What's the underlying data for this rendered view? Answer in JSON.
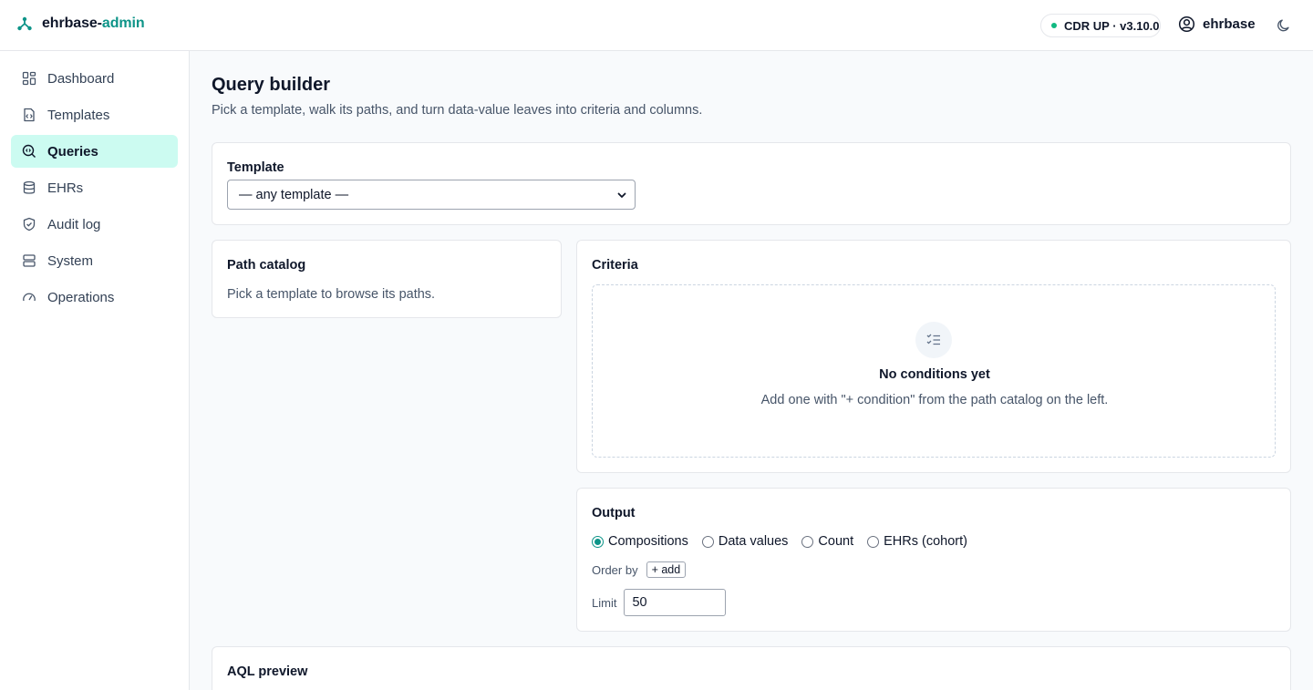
{
  "app": {
    "brand_main": "ehrbase-",
    "brand_accent": "admin",
    "status_pill": "CDR UP · v3.10.0",
    "user_name": "ehrbase"
  },
  "sidebar": {
    "items": [
      {
        "label": "Dashboard",
        "icon": "dashboard-icon"
      },
      {
        "label": "Templates",
        "icon": "templates-icon"
      },
      {
        "label": "Queries",
        "icon": "queries-icon",
        "active": true
      },
      {
        "label": "EHRs",
        "icon": "database-icon"
      },
      {
        "label": "Audit log",
        "icon": "shield-icon"
      },
      {
        "label": "System",
        "icon": "server-icon"
      },
      {
        "label": "Operations",
        "icon": "gauge-icon"
      }
    ]
  },
  "page": {
    "title": "Query builder",
    "subtitle": "Pick a template, walk its paths, and turn data-value leaves into criteria and columns."
  },
  "template_card": {
    "title": "Template",
    "selected": "— any template —"
  },
  "path_catalog": {
    "title": "Path catalog",
    "hint": "Pick a template to browse its paths."
  },
  "criteria": {
    "title": "Criteria",
    "empty_title": "No conditions yet",
    "empty_desc": "Add one with \"+ condition\" from the path catalog on the left."
  },
  "output": {
    "title": "Output",
    "options": [
      "Compositions",
      "Data values",
      "Count",
      "EHRs (cohort)"
    ],
    "selected": "Compositions",
    "order_by_label": "Order by",
    "add_label": "+ add",
    "limit_label": "Limit",
    "limit_value": "50"
  },
  "aql_preview": {
    "title": "AQL preview"
  },
  "colors": {
    "accent": "#0d9488",
    "active_bg": "#ccfbf1",
    "status_dot": "#10b981"
  }
}
